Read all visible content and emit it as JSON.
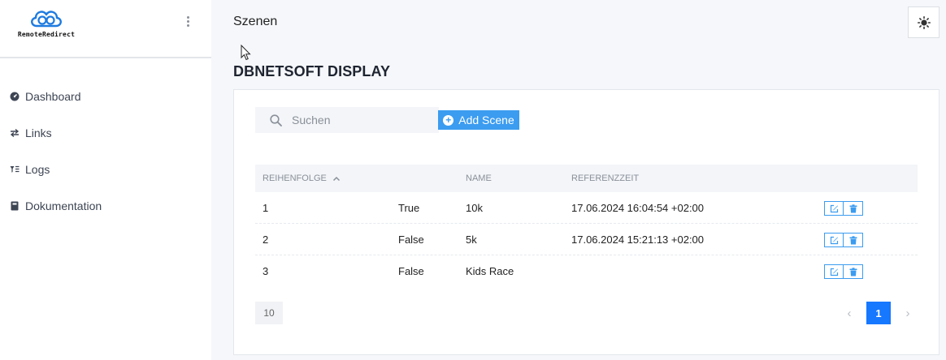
{
  "app": {
    "name": "RemoteRedirect"
  },
  "sidebar": {
    "items": [
      {
        "label": "Dashboard",
        "icon": "dashboard-icon"
      },
      {
        "label": "Links",
        "icon": "swap-icon"
      },
      {
        "label": "Logs",
        "icon": "filter-list-icon"
      },
      {
        "label": "Dokumentation",
        "icon": "book-icon"
      }
    ]
  },
  "header": {
    "title": "Szenen",
    "theme_icon": "sun-icon"
  },
  "section": {
    "title": "DBNETSOFT DISPLAY"
  },
  "toolbar": {
    "search_placeholder": "Suchen",
    "add_label": "Add Scene",
    "accent": "#3b9cf0"
  },
  "table": {
    "headers": {
      "order": "Reihenfolge",
      "name": "Name",
      "reference": "Referenzzeit"
    },
    "rows": [
      {
        "order": "1",
        "active": "True",
        "name": "10k",
        "reference": "17.06.2024 16:04:54 +02:00"
      },
      {
        "order": "2",
        "active": "False",
        "name": "5k",
        "reference": "17.06.2024 15:21:13 +02:00"
      },
      {
        "order": "3",
        "active": "False",
        "name": "Kids Race",
        "reference": ""
      }
    ]
  },
  "pagination": {
    "page_size": "10",
    "current_page": "1",
    "active_color": "#1677ff"
  }
}
